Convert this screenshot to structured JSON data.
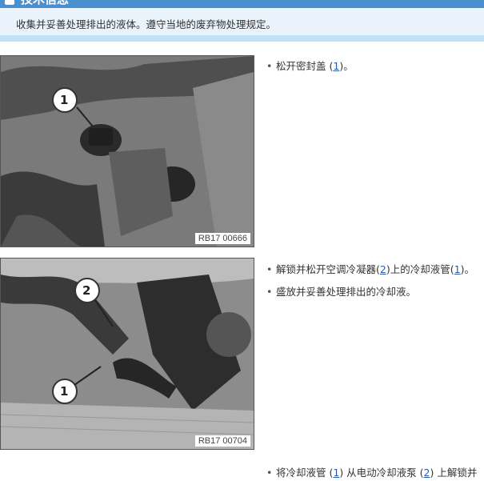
{
  "header": {
    "title": "技术信息"
  },
  "note": {
    "text": "收集并妥善处理排出的液体。遵守当地的废弃物处理规定。"
  },
  "figures": [
    {
      "code": "RB17 00666",
      "callouts": [
        "1"
      ]
    },
    {
      "code": "RB17 00704",
      "callouts": [
        "2",
        "1"
      ]
    }
  ],
  "steps": [
    {
      "before": "松开密封盖 (",
      "ref1": "1",
      "after": ")。"
    },
    {
      "before": "解锁并松开空调冷凝器(",
      "ref1": "2",
      "middle": ")上的冷却液管(",
      "ref2": "1",
      "after": ")。"
    },
    {
      "text": "盛放并妥善处理排出的冷却液。"
    },
    {
      "before": "将冷却液管 (",
      "ref1": "1",
      "middle": ") 从电动冷却液泵 (",
      "ref2": "2",
      "after": ") 上解锁并"
    }
  ]
}
